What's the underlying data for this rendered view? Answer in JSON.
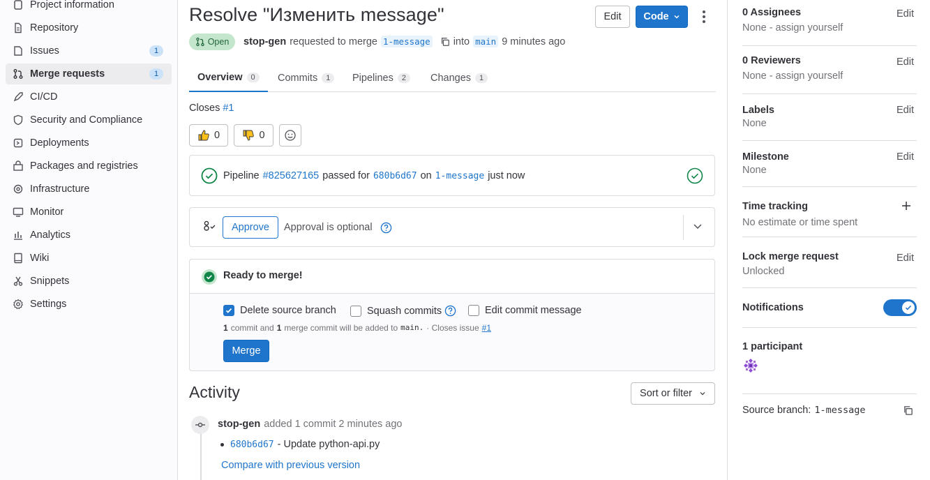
{
  "sidebar": {
    "items": [
      {
        "label": "Project information",
        "icon": "project-icon"
      },
      {
        "label": "Repository",
        "icon": "doc-icon"
      },
      {
        "label": "Issues",
        "icon": "issues-icon",
        "badge": "1"
      },
      {
        "label": "Merge requests",
        "icon": "merge-request-icon",
        "badge": "1",
        "active": true
      },
      {
        "label": "CI/CD",
        "icon": "rocket-icon"
      },
      {
        "label": "Security and Compliance",
        "icon": "shield-icon"
      },
      {
        "label": "Deployments",
        "icon": "deployments-icon"
      },
      {
        "label": "Packages and registries",
        "icon": "package-icon"
      },
      {
        "label": "Infrastructure",
        "icon": "cloud-gear-icon"
      },
      {
        "label": "Monitor",
        "icon": "monitor-icon"
      },
      {
        "label": "Analytics",
        "icon": "chart-icon"
      },
      {
        "label": "Wiki",
        "icon": "book-icon"
      },
      {
        "label": "Snippets",
        "icon": "snippet-icon"
      },
      {
        "label": "Settings",
        "icon": "settings-icon"
      }
    ]
  },
  "header": {
    "title": "Resolve \"Изменить message\"",
    "edit_label": "Edit",
    "code_label": "Code",
    "status": "Open",
    "author": "stop-gen",
    "requested_text": "requested to merge",
    "source_branch": "1-message",
    "into_text": "into",
    "target_branch": "main",
    "time_ago": "9 minutes ago"
  },
  "tabs": [
    {
      "label": "Overview",
      "count": "0"
    },
    {
      "label": "Commits",
      "count": "1"
    },
    {
      "label": "Pipelines",
      "count": "2"
    },
    {
      "label": "Changes",
      "count": "1"
    }
  ],
  "description": {
    "closes_text": "Closes",
    "closes_link": "#1"
  },
  "reactions": {
    "thumbs_up": "0",
    "thumbs_down": "0"
  },
  "pipeline": {
    "prefix": "Pipeline",
    "id": "#825627165",
    "passed_text": "passed for",
    "commit": "680b6d67",
    "on_text": "on",
    "branch": "1-message",
    "time": "just now"
  },
  "approval": {
    "button": "Approve",
    "text": "Approval is optional"
  },
  "merge": {
    "ready_text": "Ready to merge!",
    "delete_branch": "Delete source branch",
    "squash": "Squash commits",
    "edit_message": "Edit commit message",
    "summary_count1": "1",
    "summary_text1": "commit and",
    "summary_count2": "1",
    "summary_text2": "merge commit will be added to",
    "summary_branch": "main.",
    "summary_closes": "· Closes issue",
    "summary_issue": "#1",
    "merge_button": "Merge"
  },
  "activity": {
    "title": "Activity",
    "sort_label": "Sort or filter",
    "author": "stop-gen",
    "action": "added 1 commit 2 minutes ago",
    "commit_sha": "680b6d67",
    "commit_msg": "- Update python-api.py",
    "compare_link": "Compare with previous version"
  },
  "right_sidebar": {
    "assignees_title": "0 Assignees",
    "assignees_value": "None - assign yourself",
    "reviewers_title": "0 Reviewers",
    "reviewers_value": "None - assign yourself",
    "labels_title": "Labels",
    "labels_value": "None",
    "milestone_title": "Milestone",
    "milestone_value": "None",
    "time_title": "Time tracking",
    "time_value": "No estimate or time spent",
    "lock_title": "Lock merge request",
    "lock_value": "Unlocked",
    "notifications_title": "Notifications",
    "participants_title": "1 participant",
    "source_branch_label": "Source branch:",
    "source_branch_value": "1-message",
    "edit_label": "Edit"
  },
  "colors": {
    "accent": "#1f75cb",
    "success": "#108548",
    "open_bg": "#c3e6cd"
  }
}
